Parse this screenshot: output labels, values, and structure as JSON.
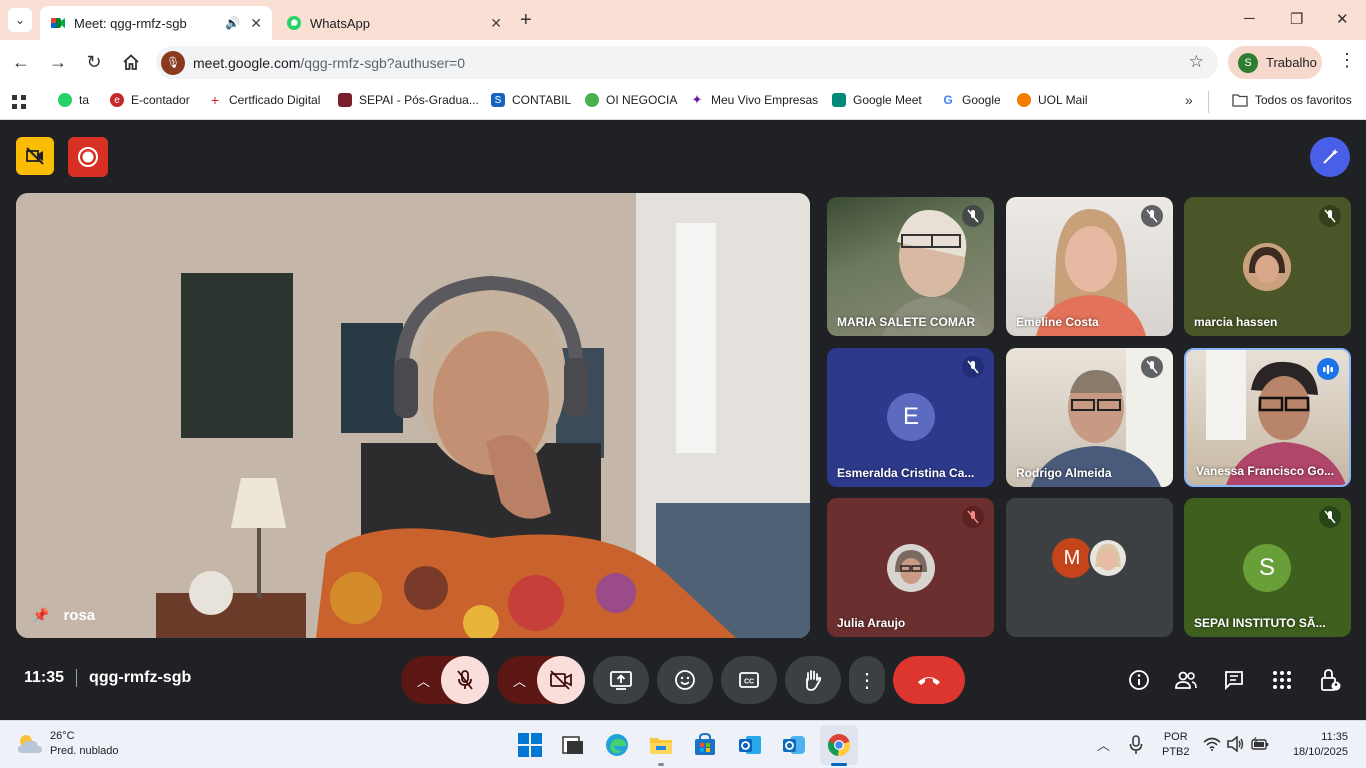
{
  "browser": {
    "tabs": [
      {
        "title": "Meet: qgg-rmfz-sgb",
        "active": true
      },
      {
        "title": "WhatsApp",
        "active": false
      }
    ],
    "url_domain": "meet.google.com",
    "url_path": "/qgg-rmfz-sgb?authuser=0",
    "profile_initial": "S",
    "profile_label": "Trabalho",
    "bookmarks": [
      {
        "label": "ta",
        "color": "#25d366"
      },
      {
        "label": "E-contador",
        "color": "#c62828"
      },
      {
        "label": "Certficado Digital",
        "color": "#c62828"
      },
      {
        "label": "SEPAI - Pós-Gradua...",
        "color": "#7a1f2b"
      },
      {
        "label": "CONTABIL",
        "color": "#1565c0"
      },
      {
        "label": "OI NEGOCIA",
        "color": "#4caf50"
      },
      {
        "label": "Meu Vivo Empresas",
        "color": "#6a1b9a"
      },
      {
        "label": "Google Meet",
        "color": "#00897b"
      },
      {
        "label": "Google",
        "color": "#4285f4"
      },
      {
        "label": "UOL Mail",
        "color": "#f57c00"
      }
    ],
    "all_bookmarks_label": "Todos os favoritos"
  },
  "meet": {
    "main_speaker": "rosa",
    "time": "11:35",
    "meeting_code": "qgg-rmfz-sgb",
    "participants": [
      {
        "name": "MARIA SALETE COMAR",
        "muted": true
      },
      {
        "name": "Emeline Costa",
        "muted": true
      },
      {
        "name": "marcia hassen",
        "muted": true
      },
      {
        "name": "Esmeralda Cristina Ca...",
        "initial": "E",
        "muted": true
      },
      {
        "name": "Rodrigo Almeida",
        "muted": true
      },
      {
        "name": "Vanessa Francisco Go...",
        "speaking": true
      },
      {
        "name": "Julia Araujo",
        "muted": true
      },
      {
        "name": "",
        "initial": "M"
      },
      {
        "name": "SEPAI INSTITUTO SÃ...",
        "initial": "S",
        "muted": true
      }
    ]
  },
  "taskbar": {
    "weather_temp": "26°C",
    "weather_desc": "Pred. nublado",
    "lang": "POR",
    "layout": "PTB2",
    "clock_time": "11:35",
    "clock_date": "18/10/2025"
  },
  "colors": {
    "meet_bg": "#202124",
    "accent_blue": "#8ab4f8",
    "hangup_red": "#ea4335",
    "tab_bar": "#f9dfd4"
  }
}
